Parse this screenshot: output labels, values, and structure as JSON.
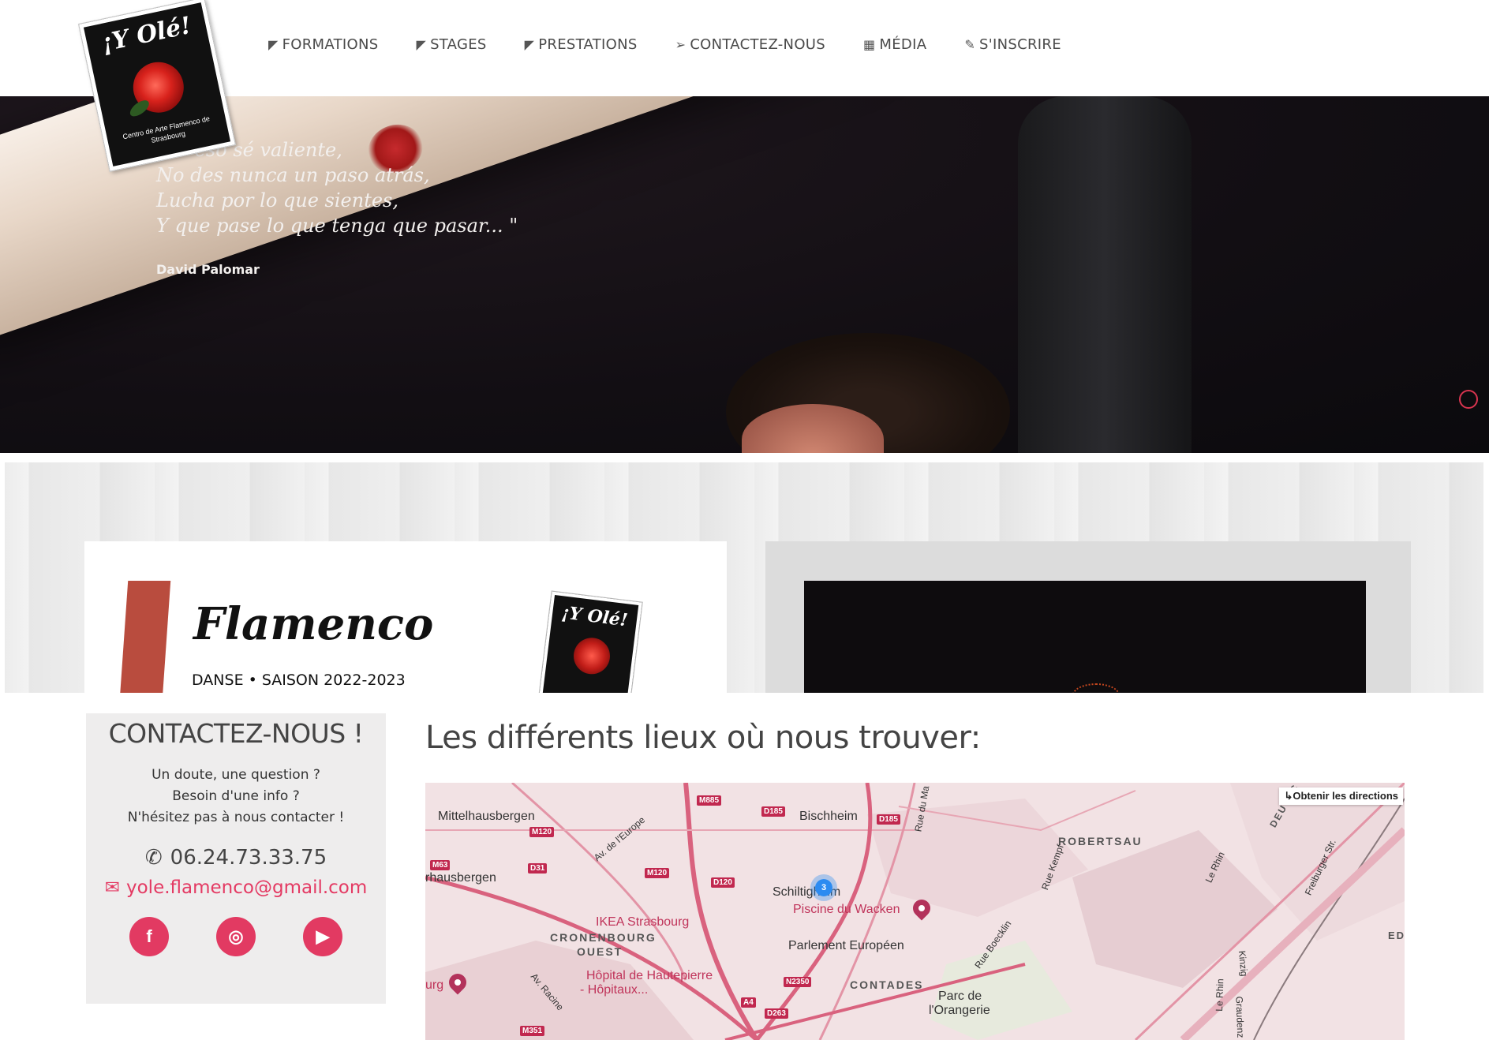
{
  "logo": {
    "brand": "¡Y Olé!",
    "subtitle": "Centro de Arte Flamenco de Strasbourg"
  },
  "nav": [
    {
      "label": "FORMATIONS",
      "icon": "fan-icon"
    },
    {
      "label": "STAGES",
      "icon": "fan-icon"
    },
    {
      "label": "PRESTATIONS",
      "icon": "fan-icon"
    },
    {
      "label": "CONTACTEZ-NOUS",
      "icon": "paper-plane-icon"
    },
    {
      "label": "MÉDIA",
      "icon": "grid-icon"
    },
    {
      "label": "S'INSCRIRE",
      "icon": "edit-icon"
    }
  ],
  "hero": {
    "quote_lines": [
      "Por eso sé valiente,",
      "No des nunca un paso atrás,",
      "Lucha por lo que sientes,",
      "Y que pase lo que tenga que pasar... \""
    ],
    "author": "David Palomar"
  },
  "flyer": {
    "title": "Flamenco",
    "subtitle": "DANSE • SAISON 2022-2023",
    "stamp_brand": "¡Y Olé!"
  },
  "contact": {
    "title": "CONTACTEZ-NOUS !",
    "lines": [
      "Un doute, une question ?",
      "Besoin d'une info ?",
      "N'hésitez pas à nous contacter !"
    ],
    "phone": "06.24.73.33.75",
    "email": "yole.flamenco@gmail.com",
    "socials": [
      {
        "name": "facebook-icon",
        "glyph": "f"
      },
      {
        "name": "instagram-icon",
        "glyph": "◎"
      },
      {
        "name": "youtube-icon",
        "glyph": "▶"
      }
    ]
  },
  "map": {
    "heading": "Les différents lieux où nous trouver:",
    "directions": "Obtenir les directions",
    "cluster_count": "3",
    "places": {
      "mittelhausbergen": "Mittelhausbergen",
      "bischheim": "Bischheim",
      "robertsau": "ROBERTSAU",
      "hausbergen": "rhausbergen",
      "schiltigheim": "Schiltigheim",
      "piscine": "Piscine du Wacken",
      "ikea": "IKEA Strasbourg",
      "cronenbourg": "CRONENBOURG",
      "ouest": "OUEST",
      "parlement": "Parlement Européen",
      "hopital1": "Hôpital de Hautepierre",
      "hopital2": "- Hôpitaux...",
      "contades": "CONTADES",
      "orangerie1": "Parc de",
      "orangerie2": "l'Orangerie",
      "burg": "urg",
      "av_europe": "Av. de l'Europe",
      "rue_kempf": "Rue Kempf",
      "rue_boecklin": "Rue Boecklin",
      "le_rhin": "Le Rhin",
      "kinzig": "Kinzig",
      "freiburger": "Freiburger Str.",
      "av_racine": "Av. Racine",
      "rue_du_ma": "Rue du Ma",
      "deutsch": "DEUTSC",
      "ed": "ED",
      "le_rhin2": "Le Rhin",
      "graudenz": "Graudenz"
    },
    "roads": [
      "M885",
      "D185",
      "D185",
      "M120",
      "M120",
      "M63",
      "D31",
      "D120",
      "N2350",
      "A4",
      "D263",
      "M351"
    ]
  }
}
